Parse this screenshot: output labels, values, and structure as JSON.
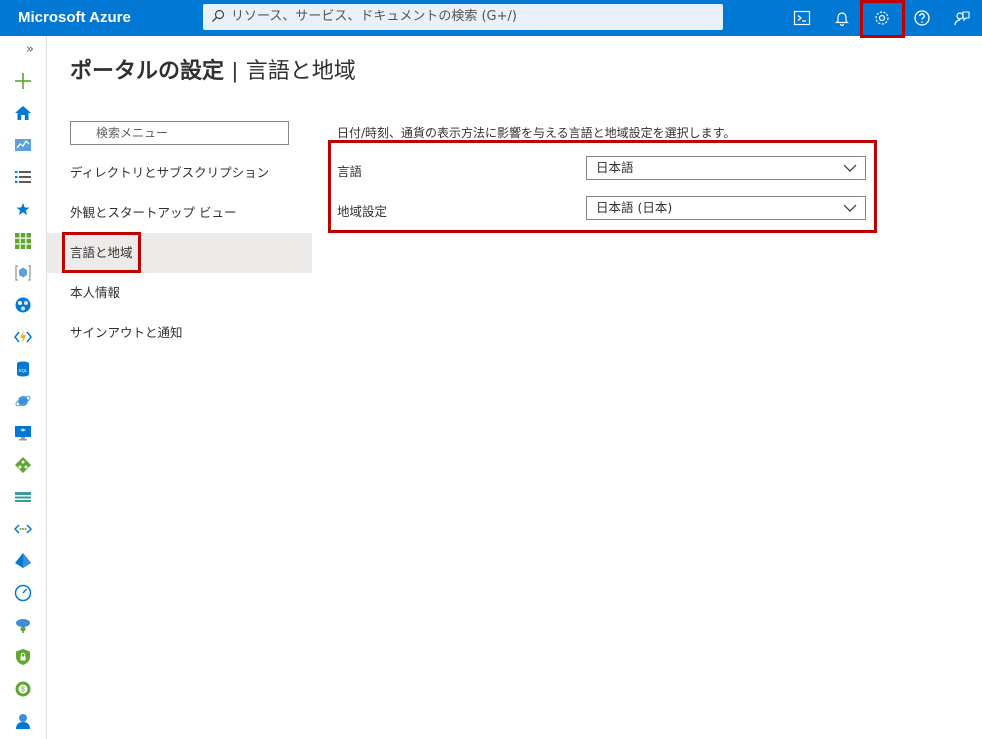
{
  "topbar": {
    "brand": "Microsoft Azure",
    "search_placeholder": "リソース、サービス、ドキュメントの検索 (G+/)",
    "buttons": [
      "cloud-shell-icon",
      "notifications-icon",
      "settings-icon",
      "help-icon",
      "feedback-icon"
    ]
  },
  "rail": {
    "expand": "»",
    "icons": [
      "create-resource-icon",
      "home-icon",
      "dashboard-icon",
      "all-services-icon",
      "favorites-icon",
      "all-resources-icon",
      "resource-groups-icon",
      "app-services-icon",
      "function-app-icon",
      "sql-database-icon",
      "cosmos-db-icon",
      "virtual-machines-icon",
      "load-balancers-icon",
      "storage-accounts-icon",
      "virtual-networks-icon",
      "azure-ad-icon",
      "monitor-icon",
      "advisor-icon",
      "security-center-icon",
      "cost-management-icon",
      "help-support-icon"
    ]
  },
  "page": {
    "title_main": "ポータルの設定",
    "title_sep": "|",
    "title_sub": "言語と地域"
  },
  "menu": {
    "search_placeholder": "検索メニュー",
    "items": [
      {
        "label": "ディレクトリとサブスクリプション"
      },
      {
        "label": "外観とスタートアップ ビュー"
      },
      {
        "label": "言語と地域"
      },
      {
        "label": "本人情報"
      },
      {
        "label": "サインアウトと通知"
      }
    ],
    "active_index": 2
  },
  "content": {
    "description": "日付/時刻、通貨の表示方法に影響を与える言語と地域設定を選択します。",
    "language_label": "言語",
    "language_value": "日本語",
    "region_label": "地域設定",
    "region_value": "日本語 (日本)"
  },
  "colors": {
    "topbar": "#0078d4",
    "highlight": "#c00000",
    "active_nav": "#edebe9"
  }
}
